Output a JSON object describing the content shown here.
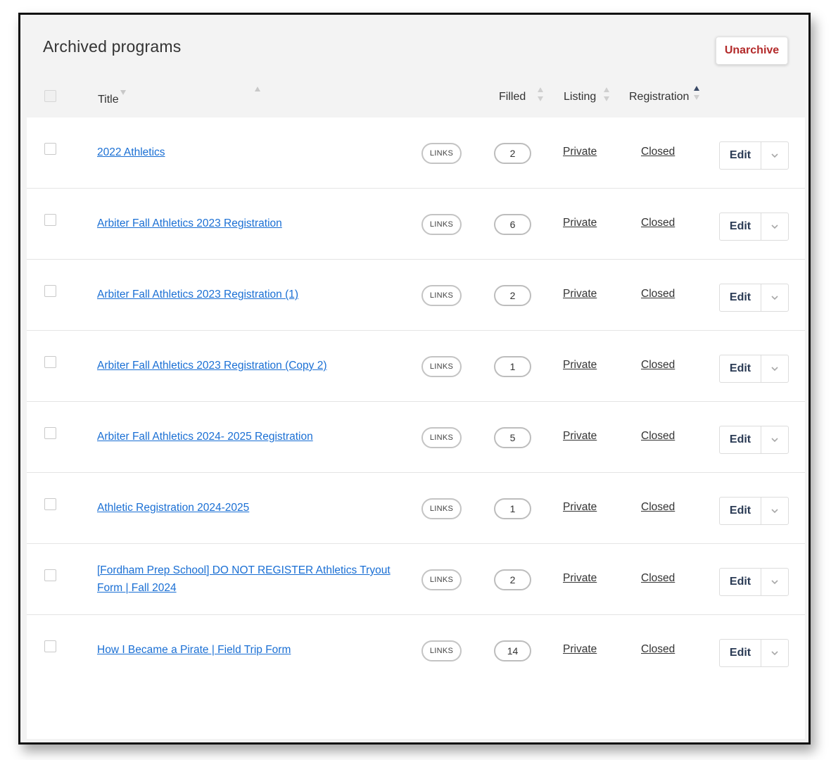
{
  "header": {
    "title": "Archived programs",
    "unarchive_label": "Unarchive"
  },
  "columns": {
    "title": "Title",
    "filled": "Filled",
    "listing": "Listing",
    "registration": "Registration"
  },
  "rows": [
    {
      "title": "2022 Athletics",
      "links_label": "LINKS",
      "filled": "2",
      "listing": "Private",
      "registration": "Closed",
      "edit_label": "Edit"
    },
    {
      "title": "Arbiter Fall Athletics 2023 Registration",
      "links_label": "LINKS",
      "filled": "6",
      "listing": "Private",
      "registration": "Closed",
      "edit_label": "Edit"
    },
    {
      "title": "Arbiter Fall Athletics 2023 Registration (1)",
      "links_label": "LINKS",
      "filled": "2",
      "listing": "Private",
      "registration": "Closed",
      "edit_label": "Edit"
    },
    {
      "title": "Arbiter Fall Athletics 2023 Registration (Copy 2)",
      "links_label": "LINKS",
      "filled": "1",
      "listing": "Private",
      "registration": "Closed",
      "edit_label": "Edit"
    },
    {
      "title": "Arbiter Fall Athletics 2024- 2025 Registration",
      "links_label": "LINKS",
      "filled": "5",
      "listing": "Private",
      "registration": "Closed",
      "edit_label": "Edit"
    },
    {
      "title": "Athletic Registration 2024-2025",
      "links_label": "LINKS",
      "filled": "1",
      "listing": "Private",
      "registration": "Closed",
      "edit_label": "Edit"
    },
    {
      "title": "[Fordham Prep School] DO NOT REGISTER Athletics Tryout Form | Fall 2024",
      "links_label": "LINKS",
      "filled": "2",
      "listing": "Private",
      "registration": "Closed",
      "edit_label": "Edit"
    },
    {
      "title": "How I Became a Pirate | Field Trip Form",
      "links_label": "LINKS",
      "filled": "14",
      "listing": "Private",
      "registration": "Closed",
      "edit_label": "Edit"
    }
  ],
  "colors": {
    "accent_red": "#b32a2a",
    "link_blue": "#1a6fd4",
    "header_bg": "#f3f3f3"
  }
}
